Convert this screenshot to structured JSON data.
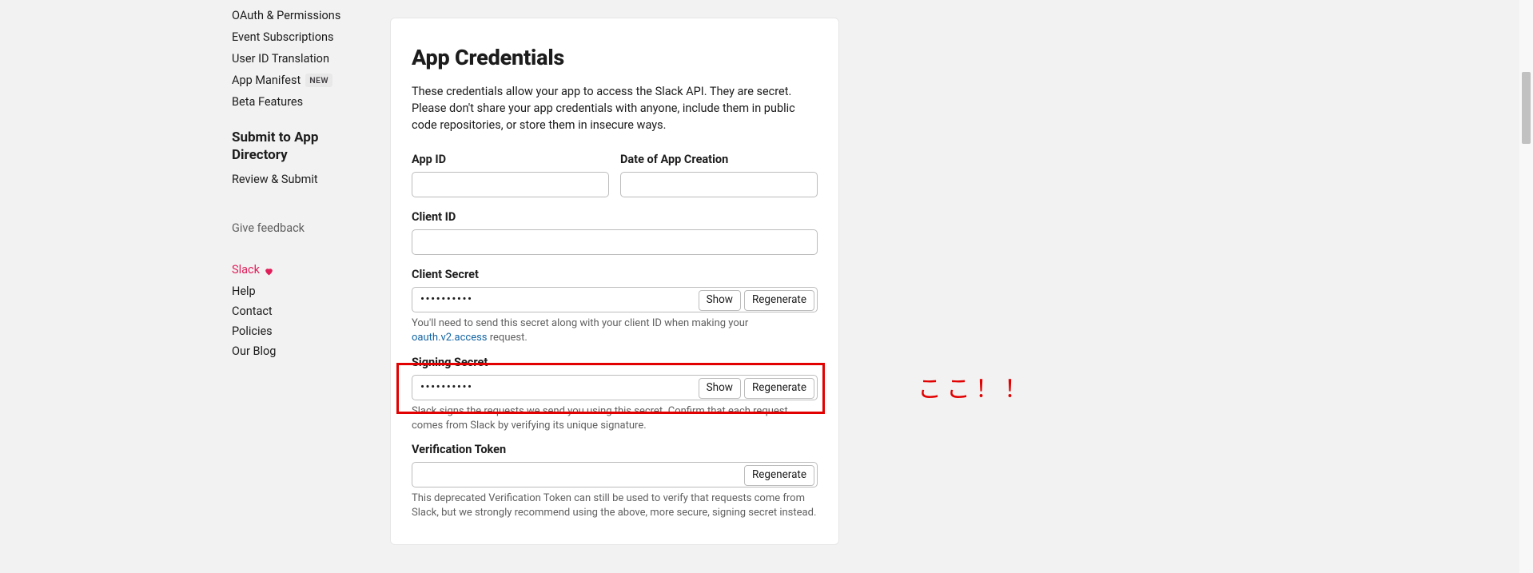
{
  "sidebar": {
    "nav": [
      {
        "label": "OAuth & Permissions"
      },
      {
        "label": "Event Subscriptions"
      },
      {
        "label": "User ID Translation"
      },
      {
        "label": "App Manifest",
        "badge": "NEW"
      },
      {
        "label": "Beta Features"
      }
    ],
    "submit_title": "Submit to App Directory",
    "submit_items": [
      {
        "label": "Review & Submit"
      }
    ],
    "feedback": "Give feedback",
    "slack_love": "Slack",
    "footer": [
      {
        "label": "Help"
      },
      {
        "label": "Contact"
      },
      {
        "label": "Policies"
      },
      {
        "label": "Our Blog"
      }
    ]
  },
  "panel": {
    "title": "App Credentials",
    "description": "These credentials allow your app to access the Slack API. They are secret. Please don't share your app credentials with anyone, include them in public code repositories, or store them in insecure ways.",
    "fields": {
      "app_id": {
        "label": "App ID",
        "value": ""
      },
      "date_created": {
        "label": "Date of App Creation",
        "value": ""
      },
      "client_id": {
        "label": "Client ID",
        "value": ""
      },
      "client_secret": {
        "label": "Client Secret",
        "masked": "••••••••••",
        "show": "Show",
        "regen": "Regenerate",
        "hint_pre": "You'll need to send this secret along with your client ID when making your ",
        "hint_link": "oauth.v2.access",
        "hint_post": " request."
      },
      "signing_secret": {
        "label": "Signing Secret",
        "masked": "••••••••••",
        "show": "Show",
        "regen": "Regenerate",
        "hint": "Slack signs the requests we send you using this secret. Confirm that each request comes from Slack by verifying its unique signature."
      },
      "verification_token": {
        "label": "Verification Token",
        "value": "",
        "regen": "Regenerate",
        "hint": "This deprecated Verification Token can still be used to verify that requests come from Slack, but we strongly recommend using the above, more secure, signing secret instead."
      }
    }
  },
  "annotation": {
    "text": "ここ！！"
  }
}
